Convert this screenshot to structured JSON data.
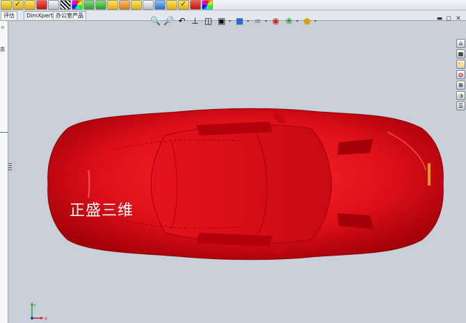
{
  "command_tabs": [
    {
      "label": "评估",
      "active": true
    },
    {
      "label": "DimXpert",
      "active": false
    },
    {
      "label": "办公室产品",
      "active": false
    }
  ],
  "left_pane": {
    "collapse_glyph": "»",
    "label": "态"
  },
  "hud_tools": [
    "zoom-to-fit-icon",
    "zoom-to-area-icon",
    "previous-view-icon",
    "section-view-icon",
    "dynamic-annotation-icon",
    "view-orientation-icon",
    "display-style-icon",
    "hide-show-items-icon",
    "edit-appearance-icon",
    "apply-scene-icon",
    "view-settings-icon"
  ],
  "watermark": "正盛三维",
  "triad": {
    "x": "X",
    "y": "Y"
  },
  "colors": {
    "body": "#e0101a",
    "background": "#c9cfd8",
    "accent": "#ff9a1a"
  }
}
